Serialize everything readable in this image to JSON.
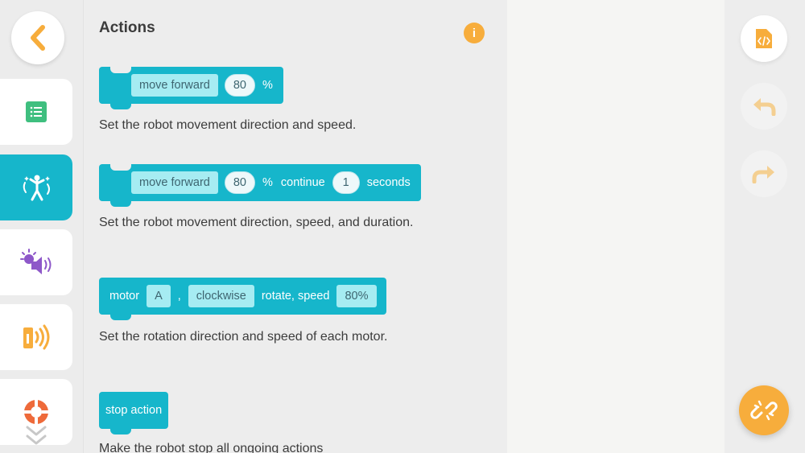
{
  "palette": {
    "title": "Actions",
    "info_label": "i"
  },
  "blocks": [
    {
      "parts": [
        "move forward",
        "80",
        "%"
      ],
      "description": "Set the robot movement direction and speed."
    },
    {
      "parts": [
        "move forward",
        "80",
        "%",
        "continue",
        "1",
        "seconds"
      ],
      "description": "Set the robot movement direction, speed, and duration."
    },
    {
      "parts": [
        "motor",
        "A",
        ",",
        "clockwise",
        "rotate, speed",
        "80%"
      ],
      "description": "Set the rotation direction and speed of each motor."
    },
    {
      "parts": [
        "stop action"
      ],
      "description": "Make the robot stop all ongoing actions"
    }
  ],
  "categories": [
    {
      "name": "notes",
      "icon": "list-icon",
      "color": "#3fbf7f"
    },
    {
      "name": "actions",
      "icon": "dancing-figure-icon",
      "color": "#16b6cb",
      "active": true
    },
    {
      "name": "light-sound",
      "icon": "light-sound-icon",
      "color": "#8e58c9"
    },
    {
      "name": "sensors",
      "icon": "sensor-signal-icon",
      "color": "#f7ad3c"
    },
    {
      "name": "control",
      "icon": "lifebuoy-icon",
      "color": "#ee6a3a"
    }
  ],
  "tools": {
    "code_icon": "code-file-icon",
    "undo_icon": "undo-icon",
    "redo_icon": "redo-icon",
    "connect_icon": "broken-link-icon"
  },
  "colors": {
    "accent": "#16b6cb",
    "orange": "#f7ad3c",
    "option_bg": "#a6ecf2"
  }
}
